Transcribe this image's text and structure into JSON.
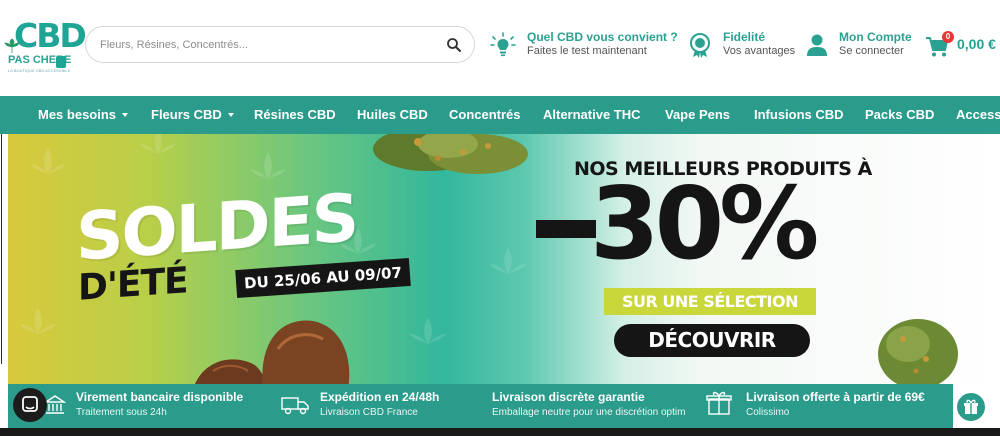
{
  "header": {
    "logo": {
      "main": "CBD",
      "sub": "PAS CHERE",
      "domain": ".com",
      "tagline": "LA BOUTIQUE CBD ACCESSIBLE"
    },
    "search": {
      "placeholder": "Fleurs, Résines, Concentrés..."
    },
    "quiz": {
      "title": "Quel CBD vous convient ?",
      "subtitle": "Faites le test maintenant",
      "icon": "lightbulb-icon"
    },
    "loyalty": {
      "title": "Fidelité",
      "subtitle": "Vos avantages",
      "icon": "medal-icon"
    },
    "account": {
      "title": "Mon Compte",
      "subtitle": "Se connecter",
      "icon": "user-icon"
    },
    "cart": {
      "count": "0",
      "amount": "0,00 €",
      "icon": "cart-icon"
    }
  },
  "nav": {
    "items": [
      {
        "label": "Mes besoins",
        "has_dropdown": true
      },
      {
        "label": "Fleurs CBD",
        "has_dropdown": true
      },
      {
        "label": "Résines CBD",
        "has_dropdown": false
      },
      {
        "label": "Huiles CBD",
        "has_dropdown": false
      },
      {
        "label": "Concentrés",
        "has_dropdown": false
      },
      {
        "label": "Alternative THC",
        "has_dropdown": false
      },
      {
        "label": "Vape Pens",
        "has_dropdown": false
      },
      {
        "label": "Infusions CBD",
        "has_dropdown": false
      },
      {
        "label": "Packs CBD",
        "has_dropdown": false
      },
      {
        "label": "Access",
        "has_dropdown": false
      }
    ]
  },
  "banner": {
    "title_line1": "SOLDES",
    "title_line2": "D'ÉTÉ",
    "dates": "DU 25/06 AU 09/07",
    "headline": "NOS MEILLEURS PRODUITS À",
    "discount": "30%",
    "selection": "SUR UNE SÉLECTION",
    "cta": "DÉCOUVRIR"
  },
  "benefits": [
    {
      "title": "Virement bancaire disponible",
      "subtitle": "Traitement sous 24h",
      "icon": "bank-icon"
    },
    {
      "title": "Expédition en 24/48h",
      "subtitle": "Livraison CBD France",
      "icon": "truck-icon"
    },
    {
      "title": "Livraison discrète garantie",
      "subtitle": "Emballage neutre pour une discrétion optim",
      "icon": "package-icon"
    },
    {
      "title": "Livraison offerte à partir de 69€",
      "subtitle": "Colissimo",
      "icon": "gift-box-icon"
    }
  ],
  "colors": {
    "brand": "#2b9c8c",
    "brand_text": "#2aa191",
    "badge": "#e53935",
    "dark": "#151515",
    "banner_yellow": "#c9d73b"
  }
}
